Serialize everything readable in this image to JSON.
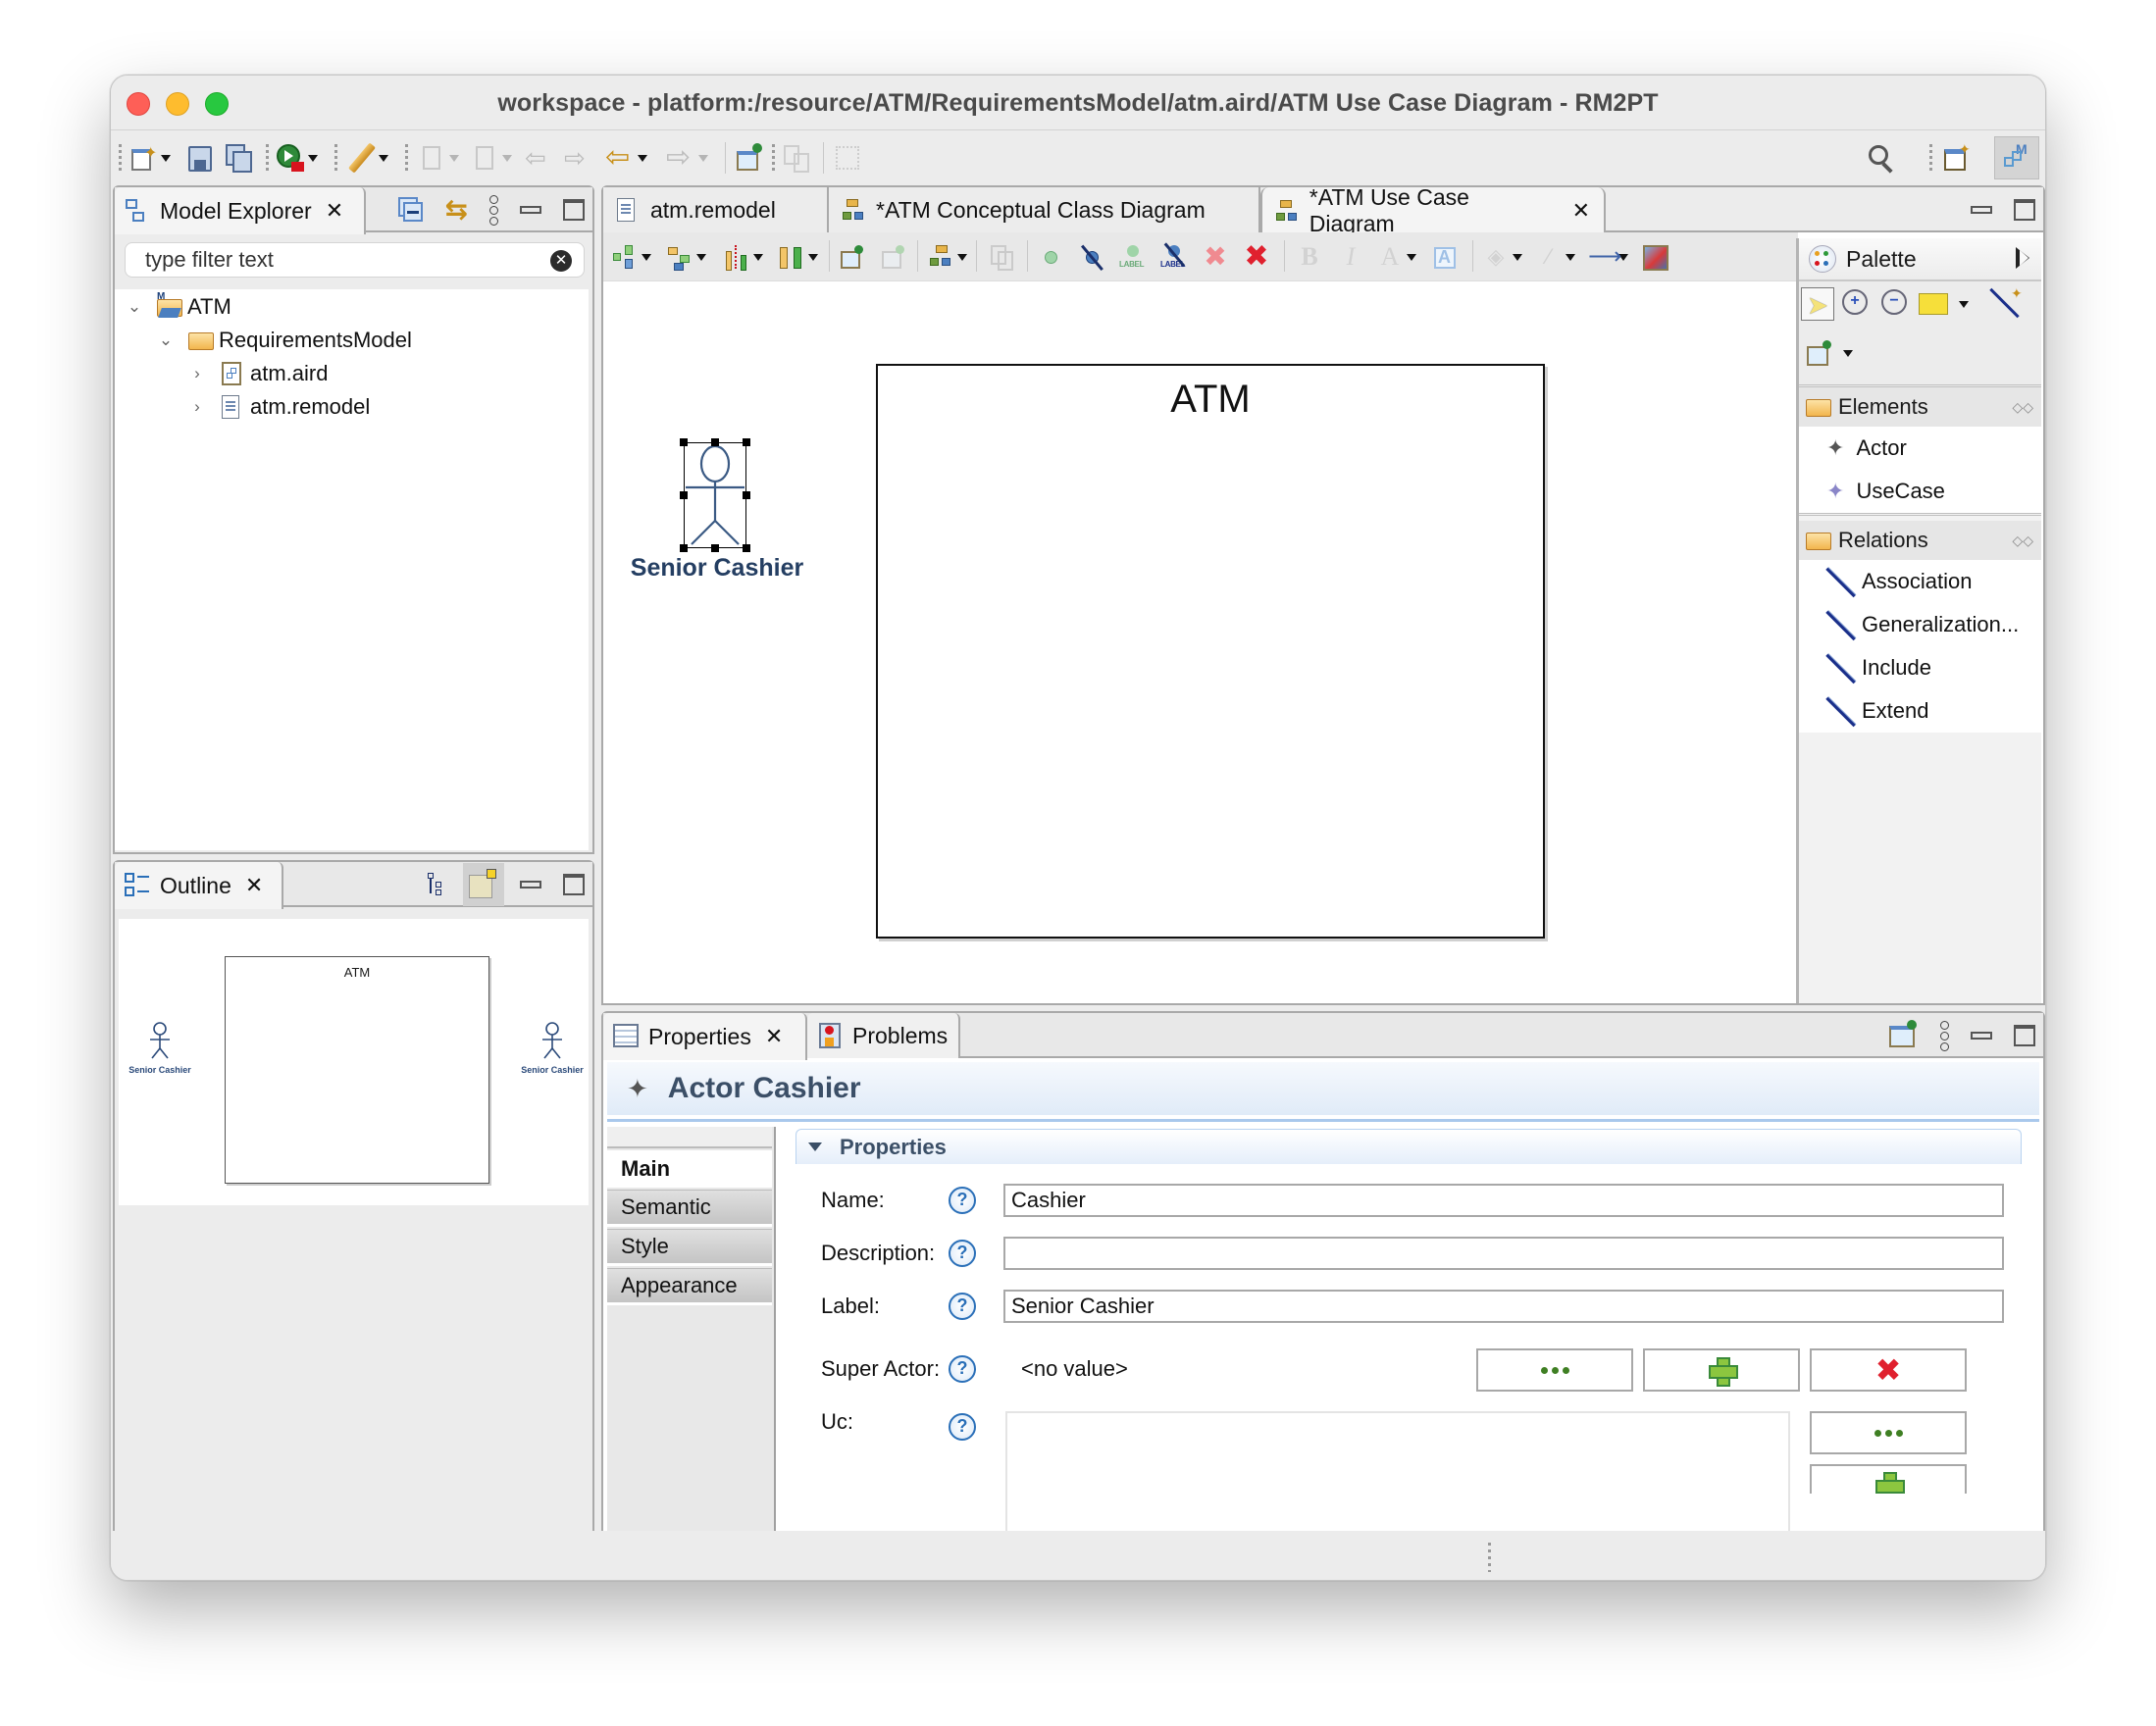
{
  "window": {
    "title": "workspace - platform:/resource/ATM/RequirementsModel/atm.aird/ATM Use Case Diagram - RM2PT"
  },
  "main_toolbar": {
    "left_icons": [
      "new-wizard-icon",
      "save-icon",
      "save-all-icon",
      "run-icon",
      "tool-pencil-icon",
      "next-annotation-icon",
      "previous-annotation-icon",
      "last-edit-icon",
      "forward-edit-icon",
      "back-icon",
      "forward-icon",
      "pin-editor-icon",
      "copy-icon",
      "layout-icon"
    ],
    "right_icons": [
      "search-icon",
      "open-perspective-icon",
      "modeling-perspective-icon"
    ]
  },
  "model_explorer": {
    "tab_label": "Model Explorer",
    "filter_placeholder": "type filter text",
    "tree": [
      {
        "label": "ATM",
        "expanded": true,
        "level": 0,
        "icon": "modeling-project-icon"
      },
      {
        "label": "RequirementsModel",
        "expanded": true,
        "level": 1,
        "icon": "folder-icon"
      },
      {
        "label": "atm.aird",
        "expanded": false,
        "level": 2,
        "icon": "aird-file-icon"
      },
      {
        "label": "atm.remodel",
        "expanded": false,
        "level": 2,
        "icon": "model-file-icon"
      }
    ]
  },
  "outline": {
    "tab_label": "Outline",
    "thumbnail": {
      "container_label": "ATM",
      "actors": [
        "Senior Cashier",
        "Senior Cashier"
      ]
    }
  },
  "editor": {
    "tabs": [
      {
        "label": "atm.remodel",
        "dirty": false,
        "active": false
      },
      {
        "label": "*ATM Conceptual Class Diagram",
        "dirty": true,
        "active": false
      },
      {
        "label": "*ATM Use Case Diagram",
        "dirty": true,
        "active": true
      }
    ],
    "diagram_toolbar_icons": [
      "arrange-icon",
      "select-group-icon",
      "distribute-icon",
      "align-icon",
      "pin-icon",
      "unpin-icon",
      "layer-icon",
      "copy-format-icon",
      "show-element-icon",
      "hide-element-icon",
      "show-label-icon",
      "hide-label-icon",
      "delete-from-diagram-icon",
      "delete-from-model-icon",
      "bold-icon",
      "italic-icon",
      "font-color-icon",
      "text-style-icon",
      "fill-color-icon",
      "line-color-icon",
      "line-style-icon",
      "export-image-icon"
    ],
    "diagram": {
      "container_label": "ATM",
      "actor_label": "Senior Cashier",
      "actor_selected": true
    }
  },
  "palette": {
    "title": "Palette",
    "tools": [
      "select-tool-icon",
      "zoom-in-icon",
      "zoom-out-icon",
      "note-icon",
      "note-attachment-icon",
      "pin-tool-icon"
    ],
    "drawers": [
      {
        "label": "Elements",
        "entries": [
          "Actor",
          "UseCase"
        ]
      },
      {
        "label": "Relations",
        "entries": [
          "Association",
          "Generalization...",
          "Include",
          "Extend"
        ]
      }
    ]
  },
  "properties_view": {
    "tabs": [
      {
        "label": "Properties",
        "active": true
      },
      {
        "label": "Problems",
        "active": false
      }
    ],
    "title": "Actor Cashier",
    "vertical_tabs": [
      "Main",
      "Semantic",
      "Style",
      "Appearance"
    ],
    "active_vertical_tab": "Main",
    "section_title": "Properties",
    "fields": {
      "name": {
        "label": "Name:",
        "value": "Cashier"
      },
      "description": {
        "label": "Description:",
        "value": ""
      },
      "label": {
        "label": "Label:",
        "value": "Senior Cashier"
      },
      "super_actor": {
        "label": "Super Actor:",
        "value": "<no value>"
      },
      "uc": {
        "label": "Uc:",
        "value": ""
      }
    },
    "help_symbol": "?"
  }
}
